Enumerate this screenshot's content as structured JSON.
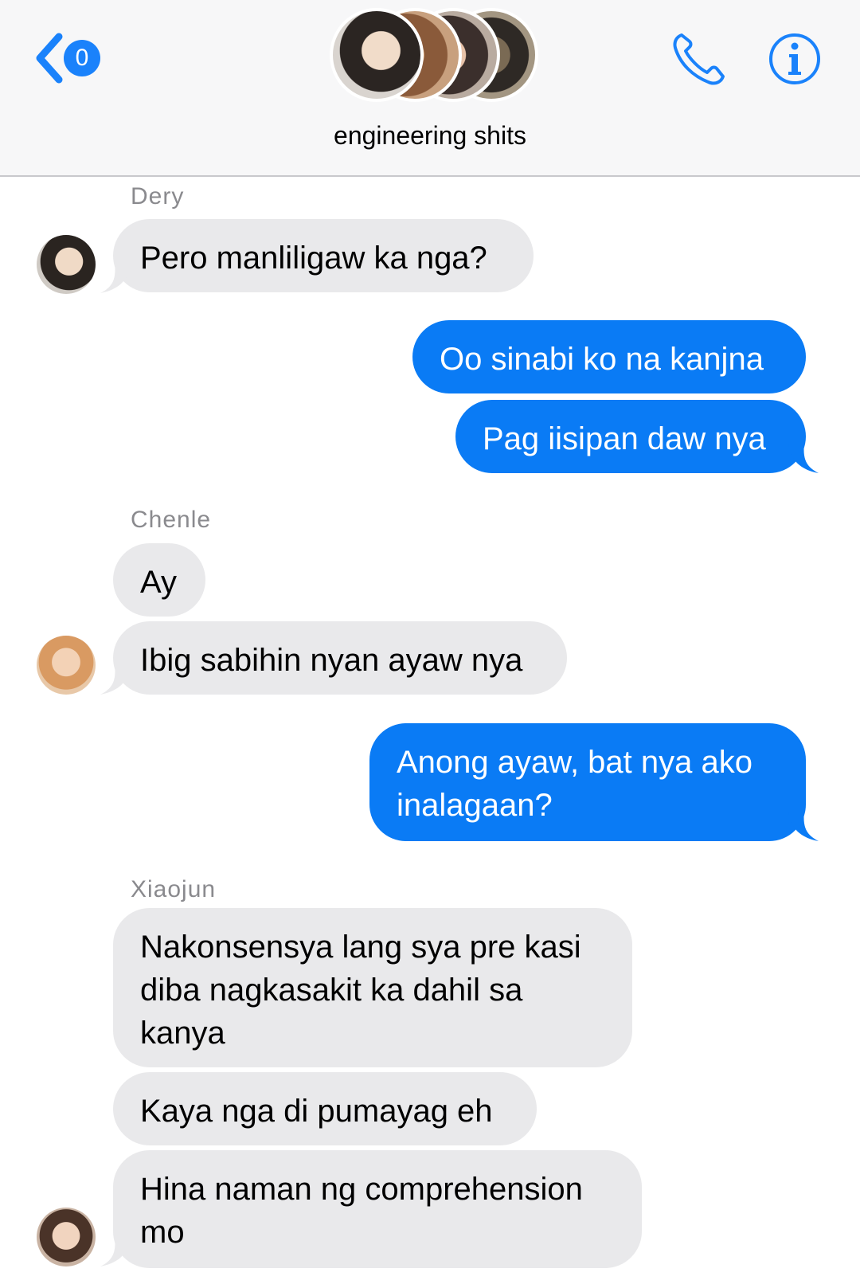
{
  "header": {
    "unread_count": "0",
    "group_name": "engineering shits",
    "accent_color": "#1a82fb",
    "icons": [
      "back-chevron-icon",
      "phone-icon",
      "info-icon"
    ]
  },
  "messages": [
    {
      "sender": "Dery",
      "direction": "incoming",
      "texts": [
        "Pero manliligaw ka nga?"
      ]
    },
    {
      "sender": "",
      "direction": "outgoing",
      "texts": [
        "Oo sinabi ko na kanjna",
        "Pag iisipan daw nya"
      ]
    },
    {
      "sender": "Chenle",
      "direction": "incoming",
      "texts": [
        "Ay",
        "Ibig sabihin nyan ayaw nya"
      ]
    },
    {
      "sender": "",
      "direction": "outgoing",
      "texts": [
        "Anong ayaw, bat nya ako inalagaan?"
      ]
    },
    {
      "sender": "Xiaojun",
      "direction": "incoming",
      "texts": [
        "Nakonsensya lang sya pre kasi diba nagkasakit ka dahil sa kanya",
        "Kaya nga di pumayag eh",
        "Hina naman ng comprehension mo"
      ]
    }
  ],
  "colors": {
    "incoming_bubble": "#e9e9eb",
    "outgoing_bubble": "#0a7bf5"
  }
}
